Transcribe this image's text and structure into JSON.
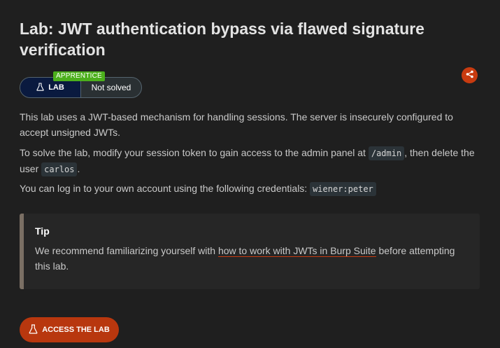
{
  "title": "Lab: JWT authentication bypass via flawed signature verification",
  "badge": {
    "level": "APPRENTICE",
    "type": "LAB",
    "status": "Not solved"
  },
  "description": {
    "p1": "This lab uses a JWT-based mechanism for handling sessions. The server is insecurely configured to accept unsigned JWTs.",
    "p2_before": "To solve the lab, modify your session token to gain access to the admin panel at ",
    "p2_code1": "/admin",
    "p2_middle": ", then delete the user ",
    "p2_code2": "carlos",
    "p2_after": ".",
    "p3_before": "You can log in to your own account using the following credentials: ",
    "p3_code": "wiener:peter"
  },
  "tip": {
    "title": "Tip",
    "before": "We recommend familiarizing yourself with ",
    "link": "how to work with JWTs in Burp Suite",
    "after": " before attempting this lab."
  },
  "access_button": "ACCESS THE LAB",
  "colors": {
    "accent": "#c83b10",
    "lab_badge": "#0a1a3f",
    "apprentice": "#4caf1c",
    "background": "#1f1f1f"
  },
  "icons": {
    "share": "share-icon",
    "flask": "flask-icon"
  }
}
